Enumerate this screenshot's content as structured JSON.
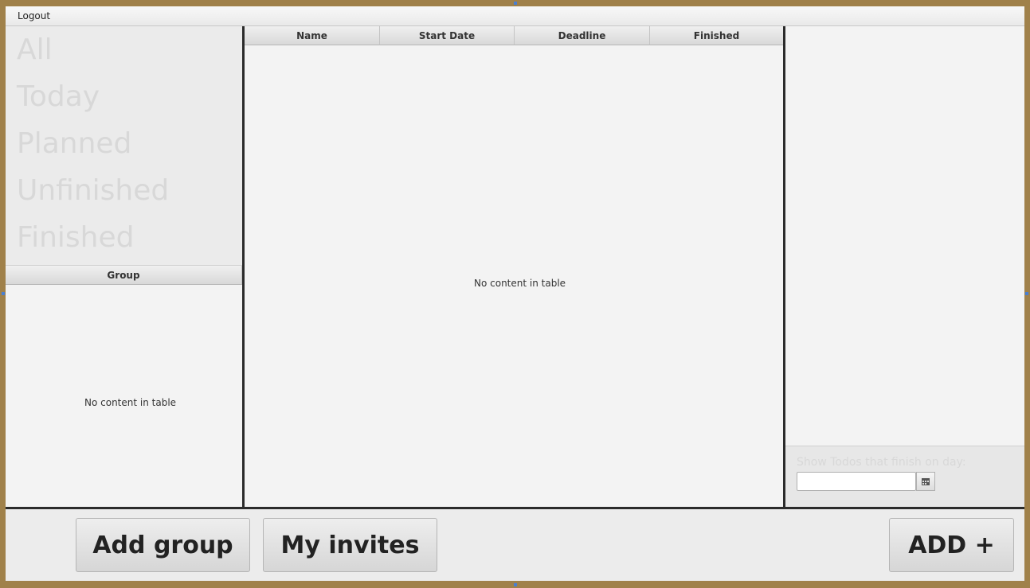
{
  "menu": {
    "logout": "Logout"
  },
  "filters": [
    "All",
    "Today",
    "Planned",
    "Unfinished",
    "Finished"
  ],
  "group_table": {
    "header": "Group",
    "empty_text": "No content in table"
  },
  "todo_table": {
    "columns": [
      "Name",
      "Start Date",
      "Deadline",
      "Finished"
    ],
    "empty_text": "No content in table"
  },
  "date_filter": {
    "label": "Show Todos that finish on day:",
    "value": "",
    "calendar_icon": "calendar-icon"
  },
  "buttons": {
    "add_group": "Add group",
    "my_invites": "My invites",
    "add": "ADD +"
  },
  "colors": {
    "frame": "#a0814a",
    "divider": "#2b2b2b",
    "filter_text": "#d8d8d8"
  }
}
